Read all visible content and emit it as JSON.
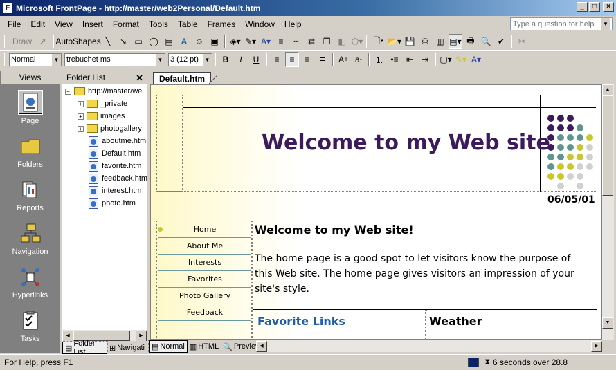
{
  "window": {
    "title": "Microsoft FrontPage - http://master/web2Personal/Default.htm"
  },
  "menu": [
    "File",
    "Edit",
    "View",
    "Insert",
    "Format",
    "Tools",
    "Table",
    "Frames",
    "Window",
    "Help"
  ],
  "ask": {
    "placeholder": "Type a question for help"
  },
  "toolbar1": {
    "draw_label": "Draw",
    "autoshapes_label": "AutoShapes"
  },
  "toolbar2": {
    "style_value": "Normal",
    "font_value": "trebuchet ms",
    "size_value": "3  (12 pt)",
    "bold": "B",
    "italic": "I",
    "underline": "U"
  },
  "views": {
    "header": "Views",
    "items": [
      {
        "label": "Page",
        "icon": "page-icon"
      },
      {
        "label": "Folders",
        "icon": "folders-icon"
      },
      {
        "label": "Reports",
        "icon": "reports-icon"
      },
      {
        "label": "Navigation",
        "icon": "navigation-icon"
      },
      {
        "label": "Hyperlinks",
        "icon": "hyperlinks-icon"
      },
      {
        "label": "Tasks",
        "icon": "tasks-icon"
      }
    ]
  },
  "folder_list": {
    "header": "Folder List",
    "root": "http://master/we",
    "folders": [
      "_private",
      "images",
      "photogallery"
    ],
    "files": [
      "aboutme.htm",
      "Default.htm",
      "favorite.htm",
      "feedback.htm",
      "interest.htm",
      "photo.htm"
    ],
    "tab_folder": "Folder List",
    "tab_nav": "Navigati"
  },
  "editor": {
    "tab": "Default.htm",
    "page_title": "Welcome to my Web site",
    "date": "06/05/01",
    "nav": [
      "Home",
      "About Me",
      "Interests",
      "Favorites",
      "Photo Gallery",
      "Feedback"
    ],
    "heading": "Welcome to my Web site!",
    "body": "The home page is a good spot to let visitors know the purpose of this Web site. The home page gives visitors an impression of your site's style.",
    "favorites_link": "Favorite Links",
    "weather": "Weather",
    "view_tabs": [
      "Normal",
      "HTML",
      "Preview"
    ]
  },
  "colors": {
    "title_purple": "#3c1a5b",
    "dot_purple": "#3c1a5b",
    "dot_teal": "#5f9490",
    "dot_yellow": "#c8c82a",
    "dot_grey": "#d0d0d0",
    "link_blue": "#1f5fa8"
  },
  "status": {
    "left": "For Help, press F1",
    "right": "6 seconds over 28.8"
  }
}
